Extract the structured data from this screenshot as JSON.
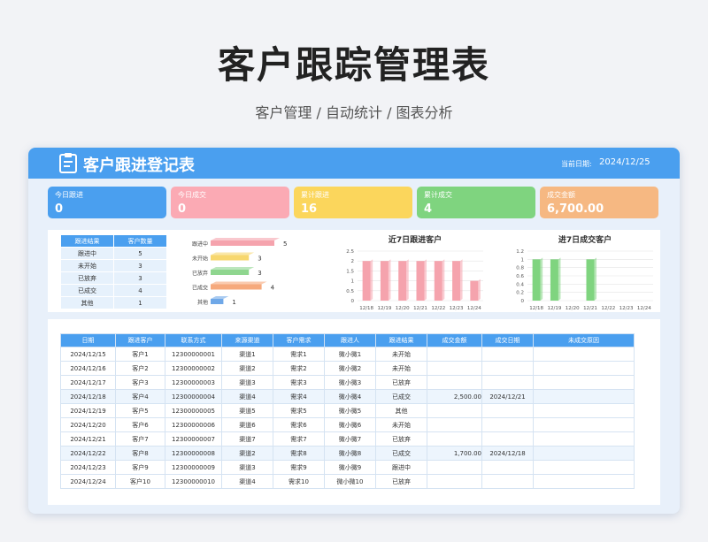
{
  "page": {
    "title": "客户跟踪管理表",
    "subtitle": "客户管理 / 自动统计 / 图表分析"
  },
  "header": {
    "title": "客户跟进登记表",
    "date_label": "当前日期:",
    "date": "2024/12/25",
    "icon": "clipboard-icon"
  },
  "kpis": [
    {
      "label": "今日跟进",
      "value": "0",
      "color": "#4a9fef"
    },
    {
      "label": "今日成交",
      "value": "0",
      "color": "#fbaab4"
    },
    {
      "label": "累计跟进",
      "value": "16",
      "color": "#fbd65c"
    },
    {
      "label": "累计成交",
      "value": "4",
      "color": "#7fd47f"
    },
    {
      "label": "成交金额",
      "value": "6,700.00",
      "color": "#f6b882"
    }
  ],
  "summary": {
    "headers": [
      "跟进结果",
      "客户数量"
    ],
    "rows": [
      [
        "跟进中",
        "5"
      ],
      [
        "未开始",
        "3"
      ],
      [
        "已放弃",
        "3"
      ],
      [
        "已成交",
        "4"
      ],
      [
        "其他",
        "1"
      ]
    ]
  },
  "chart_data": [
    {
      "type": "bar",
      "orientation": "horizontal",
      "categories": [
        "跟进中",
        "未开始",
        "已放弃",
        "已成交",
        "其他"
      ],
      "values": [
        5,
        3,
        3,
        4,
        1
      ],
      "colors": [
        "#f5a3ad",
        "#f7d76e",
        "#8fd68f",
        "#f6a97c",
        "#6fa8e8"
      ],
      "title": "",
      "xlabel": "",
      "ylabel": ""
    },
    {
      "type": "bar",
      "title": "近7日跟进客户",
      "categories": [
        "12/18",
        "12/19",
        "12/20",
        "12/21",
        "12/22",
        "12/23",
        "12/24"
      ],
      "values": [
        2,
        2,
        2,
        2,
        2,
        2,
        1
      ],
      "ylim": [
        0,
        2.5
      ],
      "yticks": [
        "0",
        "0.5",
        "1",
        "1.5",
        "2",
        "2.5"
      ],
      "color": "#f5a3ad",
      "grid": true,
      "xlabel": "",
      "ylabel": ""
    },
    {
      "type": "bar",
      "title": "进7日成交客户",
      "categories": [
        "12/18",
        "12/19",
        "12/20",
        "12/21",
        "12/22",
        "12/23",
        "12/24"
      ],
      "values": [
        1,
        1,
        0,
        1,
        0,
        0,
        0
      ],
      "ylim": [
        0,
        1.2
      ],
      "yticks": [
        "0",
        "0.2",
        "0.4",
        "0.6",
        "0.8",
        "1",
        "1.2"
      ],
      "color": "#7fd47f",
      "grid": true,
      "xlabel": "",
      "ylabel": ""
    }
  ],
  "table": {
    "headers": [
      "日期",
      "跟进客户",
      "联系方式",
      "来源渠道",
      "客户需求",
      "跟进人",
      "跟进结果",
      "成交金额",
      "成交日期",
      "未成交原因"
    ],
    "rows": [
      [
        "2024/12/15",
        "客户1",
        "12300000001",
        "渠道1",
        "需求1",
        "微小微1",
        "未开始",
        "",
        "",
        ""
      ],
      [
        "2024/12/16",
        "客户2",
        "12300000002",
        "渠道2",
        "需求2",
        "微小微2",
        "未开始",
        "",
        "",
        ""
      ],
      [
        "2024/12/17",
        "客户3",
        "12300000003",
        "渠道3",
        "需求3",
        "微小微3",
        "已放弃",
        "",
        "",
        ""
      ],
      [
        "2024/12/18",
        "客户4",
        "12300000004",
        "渠道4",
        "需求4",
        "微小微4",
        "已成交",
        "2,500.00",
        "2024/12/21",
        ""
      ],
      [
        "2024/12/19",
        "客户5",
        "12300000005",
        "渠道5",
        "需求5",
        "微小微5",
        "其他",
        "",
        "",
        ""
      ],
      [
        "2024/12/20",
        "客户6",
        "12300000006",
        "渠道6",
        "需求6",
        "微小微6",
        "未开始",
        "",
        "",
        ""
      ],
      [
        "2024/12/21",
        "客户7",
        "12300000007",
        "渠道7",
        "需求7",
        "微小微7",
        "已放弃",
        "",
        "",
        ""
      ],
      [
        "2024/12/22",
        "客户8",
        "12300000008",
        "渠道2",
        "需求8",
        "微小微8",
        "已成交",
        "1,700.00",
        "2024/12/18",
        ""
      ],
      [
        "2024/12/23",
        "客户9",
        "12300000009",
        "渠道3",
        "需求9",
        "微小微9",
        "跟进中",
        "",
        "",
        ""
      ],
      [
        "2024/12/24",
        "客户10",
        "12300000010",
        "渠道4",
        "需求10",
        "微小微10",
        "已放弃",
        "",
        "",
        ""
      ]
    ],
    "highlight_rows": [
      3,
      7
    ]
  }
}
